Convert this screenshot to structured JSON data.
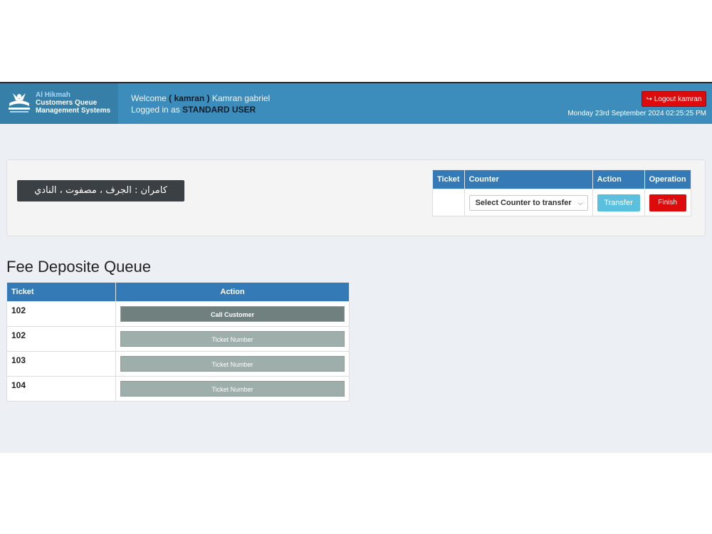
{
  "brand": {
    "line1": "Al Hikmah",
    "line2": "Customers Queue",
    "line3": "Management Systems"
  },
  "header": {
    "welcome_prefix": "Welcome",
    "username": "( kamran )",
    "full_name": "Kamran gabriel",
    "logged_in_prefix": "Logged in as",
    "role": "STANDARD USER",
    "logout_label": "Logout kamran",
    "datetime": "Monday 23rd September 2024 02:25:25 PM"
  },
  "panel": {
    "customer_name": "كامران : الجرف ، مصفوت ، النادي",
    "columns": [
      "Ticket",
      "Counter",
      "Action",
      "Operation"
    ],
    "ticket_value": "",
    "counter_select": "Select Counter to transfer",
    "transfer_label": "Transfer",
    "finish_label": "Finish"
  },
  "queue": {
    "title": "Fee Deposite Queue",
    "columns": [
      "Ticket",
      "Action"
    ],
    "rows": [
      {
        "ticket": "102",
        "action": "Call Customer"
      },
      {
        "ticket": "102",
        "action": "Ticket Number"
      },
      {
        "ticket": "103",
        "action": "Ticket Number"
      },
      {
        "ticket": "104",
        "action": "Ticket Number"
      }
    ]
  },
  "colors": {
    "header": "#3c8dbc",
    "brand": "#367fa9",
    "table_header": "#337ab7",
    "danger": "#dd0b0b",
    "info": "#5bc0de"
  },
  "icons": {
    "logout": "sign-out-icon",
    "select": "chevron-down-icon"
  }
}
